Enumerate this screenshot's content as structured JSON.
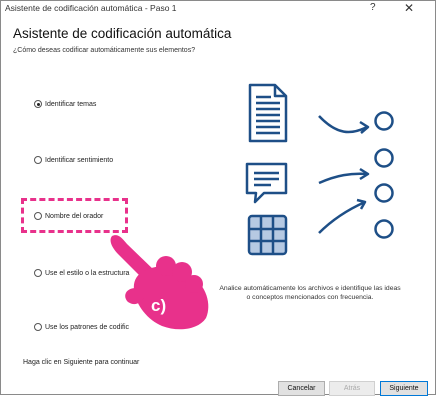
{
  "window": {
    "title": "Asistente de codificación automática - Paso 1",
    "help_glyph": "?",
    "close_glyph": "✕"
  },
  "main": {
    "heading": "Asistente de codificación automática",
    "subheading": "¿Cómo deseas codificar automáticamente sus elementos?",
    "options": [
      {
        "label": "Identificar temas",
        "selected": true
      },
      {
        "label": "Identificar sentimiento",
        "selected": false
      },
      {
        "label": "Nombre del orador",
        "selected": false
      },
      {
        "label": "Use el estilo o la estructura",
        "selected": false
      },
      {
        "label": "Use los patrones de codific",
        "selected": false
      }
    ],
    "description": "Analice automáticamente los archivos e identifique las ideas o conceptos mencionados con frecuencia.",
    "footer_hint": "Haga clic en Siguiente para continuar"
  },
  "buttons": {
    "cancel": "Cancelar",
    "back": "Atrás",
    "next": "Siguiente"
  },
  "annotation": {
    "label": "c)",
    "color": "#e8318b"
  },
  "icons": {
    "document": "document-icon",
    "speech": "speech-bubble-icon",
    "grid": "table-grid-icon",
    "arrow": "arrow-icon",
    "node": "circle-node-icon",
    "hand": "pointing-hand-icon"
  },
  "colors": {
    "illustration": "#1e4f87",
    "grid_fill": "#b6c9e2"
  }
}
